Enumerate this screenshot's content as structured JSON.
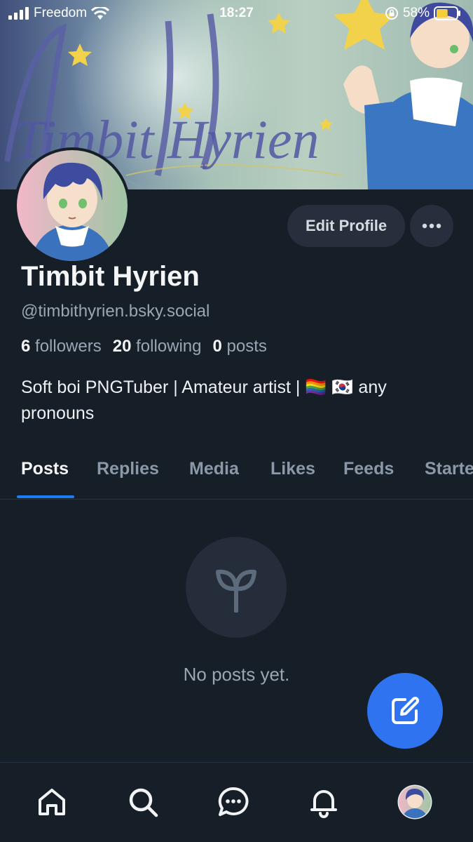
{
  "status_bar": {
    "carrier": "Freedom",
    "time": "18:27",
    "battery_percent": "58%",
    "battery_level": 0.58
  },
  "banner": {
    "signature_text": "Timbit Hyrien"
  },
  "profile": {
    "display_name": "Timbit Hyrien",
    "handle": "@timbithyrien.bsky.social",
    "followers_count": "6",
    "followers_label": "followers",
    "following_count": "20",
    "following_label": "following",
    "posts_count": "0",
    "posts_label": "posts",
    "bio": "Soft boi PNGTuber | Amateur artist | 🏳️‍🌈 🇰🇷 any pronouns"
  },
  "actions": {
    "edit_profile_label": "Edit Profile",
    "more_icon": "ellipsis-icon"
  },
  "tabs": [
    {
      "label": "Posts",
      "active": true
    },
    {
      "label": "Replies"
    },
    {
      "label": "Media"
    },
    {
      "label": "Likes"
    },
    {
      "label": "Feeds"
    },
    {
      "label": "Starte"
    }
  ],
  "empty_state": {
    "icon": "sprout-icon",
    "text": "No posts yet."
  },
  "fab": {
    "icon": "compose-icon"
  },
  "bottom_nav": [
    "home-icon",
    "search-icon",
    "chat-icon",
    "bell-icon",
    "avatar"
  ],
  "colors": {
    "background": "#161e27",
    "accent": "#1d7df2",
    "fab": "#2f73f0",
    "muted_text": "#9aa6b4"
  }
}
